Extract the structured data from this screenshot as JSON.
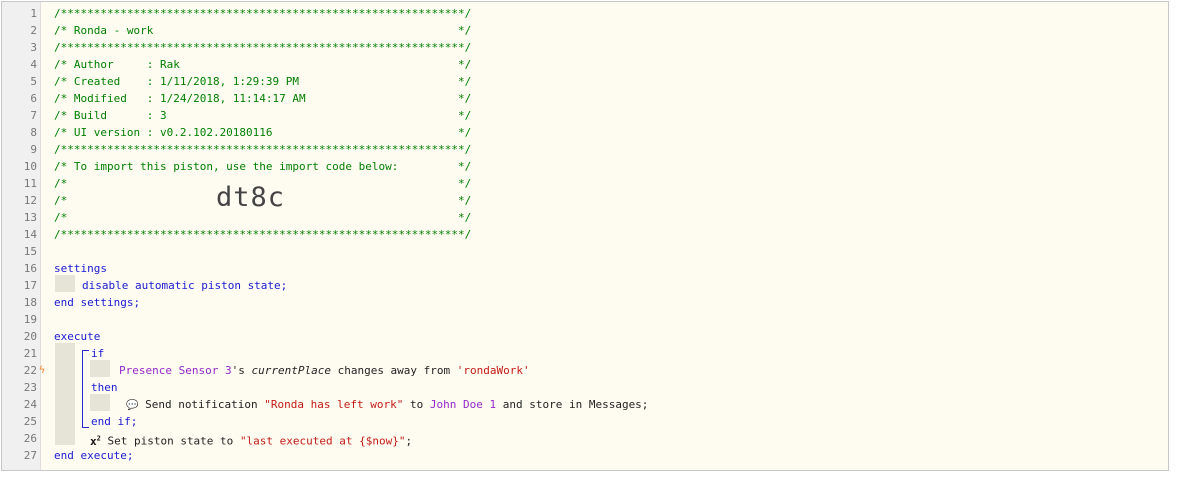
{
  "lines": {
    "1": "/*************************************************************/",
    "2": "/* Ronda - work                                              */",
    "3": "/*************************************************************/",
    "4": "/* Author     : Rak                                          */",
    "5": "/* Created    : 1/11/2018, 1:29:39 PM                        */",
    "6": "/* Modified   : 1/24/2018, 11:14:17 AM                       */",
    "7": "/* Build      : 3                                            */",
    "8": "/* UI version : v0.2.102.20180116                            */",
    "9": "/*************************************************************/",
    "10": "/* To import this piston, use the import code below:         */",
    "11": "/*                                                           */",
    "12": "/*                                                           */",
    "13": "/*                                                           */",
    "14": "/*************************************************************/",
    "16": "settings",
    "17": "disable automatic piston state;",
    "18": "end settings;",
    "20": "execute",
    "21": "if",
    "23": "then",
    "25": "end if;",
    "27": "end execute;"
  },
  "line_numbers": [
    "1",
    "2",
    "3",
    "4",
    "5",
    "6",
    "7",
    "8",
    "9",
    "10",
    "11",
    "12",
    "13",
    "14",
    "15",
    "16",
    "17",
    "18",
    "19",
    "20",
    "21",
    "22",
    "23",
    "24",
    "25",
    "26",
    "27"
  ],
  "import_code": "dt8c",
  "condition": {
    "device": "Presence Sensor 3",
    "possessive": "'s",
    "attribute": "currentPlace",
    "operator": "changes away from",
    "value": "'rondaWork'"
  },
  "notify": {
    "icon": "speech-bubble-icon",
    "icon_glyph": "💬",
    "prefix": "Send notification",
    "message": "\"Ronda has left work\"",
    "to": "to",
    "recipient": "John Doe 1",
    "suffix": "and store in Messages;"
  },
  "set_state": {
    "icon": "x-squared-icon",
    "icon_base": "x",
    "icon_sup": "2",
    "prefix": "Set piston state to",
    "value": "\"last executed at {$now}\"",
    "suffix": ";"
  },
  "trigger_marker": {
    "icon": "lightning-bolt-icon",
    "glyph": "ϟ",
    "color": "#f0822e"
  },
  "colors": {
    "comment": "#007f00",
    "keyword": "#1a1ad2",
    "device": "#9528c9",
    "string": "#c41a16",
    "background": "#fefcf1"
  }
}
